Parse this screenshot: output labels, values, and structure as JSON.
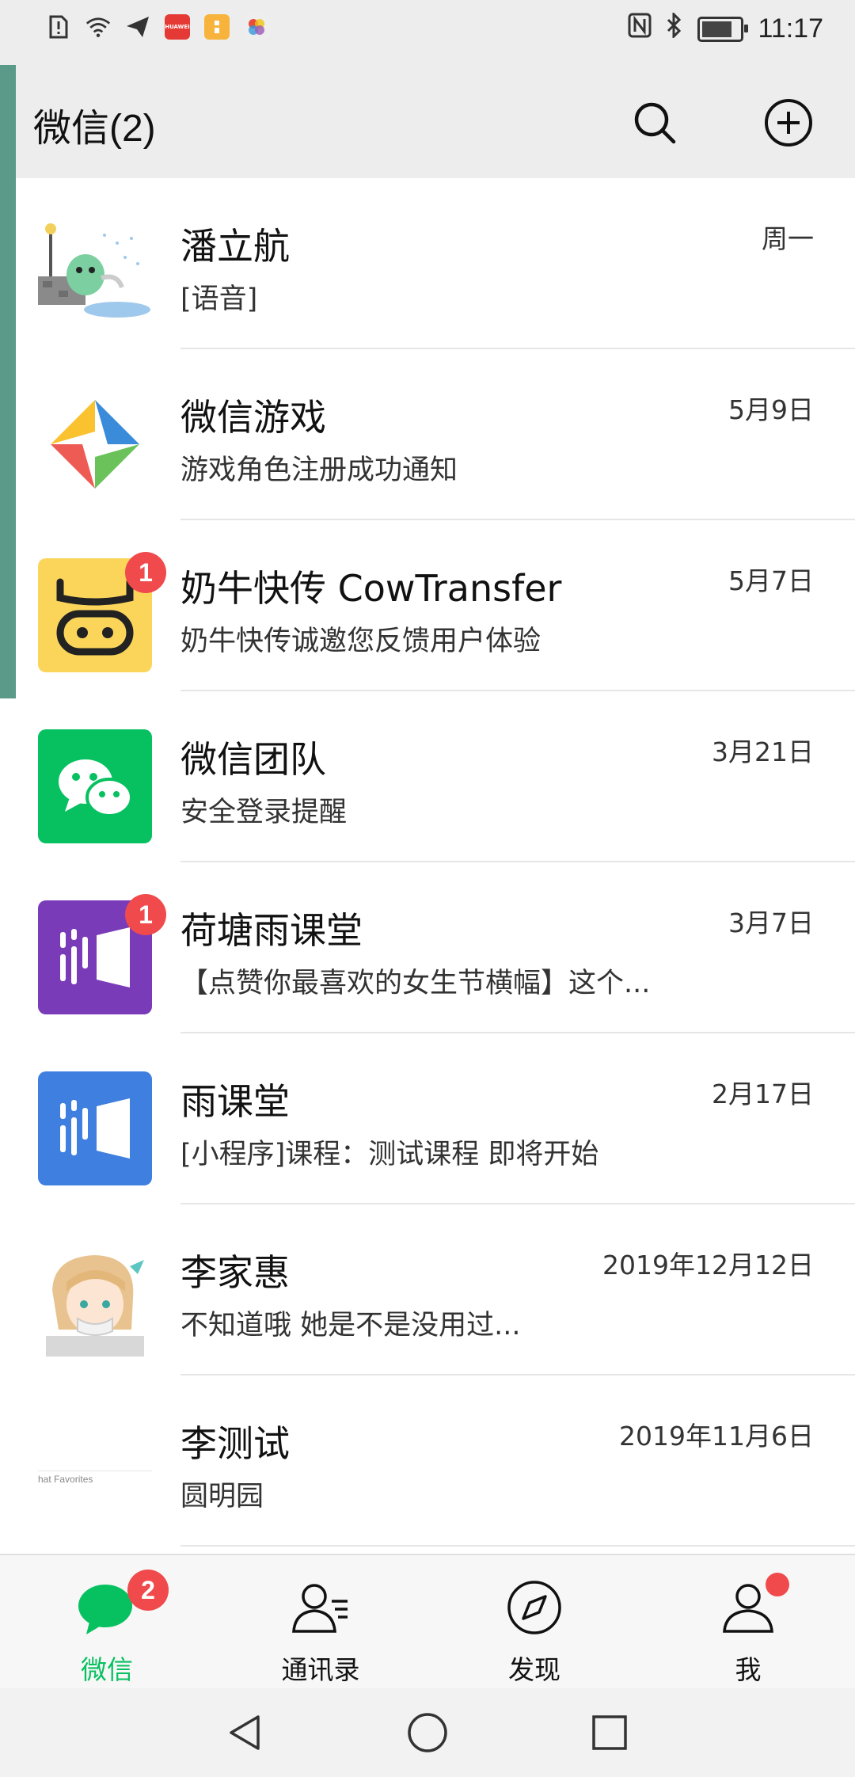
{
  "status_bar": {
    "time": "11:17",
    "left_icons": [
      "notification-alert-icon",
      "wifi-icon",
      "send-icon",
      "huawei-app-icon",
      "orange-app-icon",
      "photos-app-icon"
    ],
    "right_icons": [
      "nfc-icon",
      "bluetooth-icon",
      "battery-icon"
    ],
    "huawei_label": "HUAWEI"
  },
  "header": {
    "title": "微信(2)",
    "search_icon": "search-icon",
    "add_icon": "add-circle-icon"
  },
  "chats": [
    {
      "name": "潘立航",
      "preview": "[语音]",
      "time": "周一",
      "badge": "",
      "avatar": "cartoon-dinosaur"
    },
    {
      "name": "微信游戏",
      "preview": "游戏角色注册成功通知",
      "time": "5月9日",
      "badge": "",
      "avatar": "wechat-games-logo"
    },
    {
      "name": "奶牛快传 CowTransfer",
      "preview": "奶牛快传诚邀您反馈用户体验",
      "time": "5月7日",
      "badge": "1",
      "avatar": "cowtransfer-logo"
    },
    {
      "name": "微信团队",
      "preview": "安全登录提醒",
      "time": "3月21日",
      "badge": "",
      "avatar": "wechat-team-logo"
    },
    {
      "name": "荷塘雨课堂",
      "preview": "【点赞你最喜欢的女生节横幅】这个...",
      "time": "3月7日",
      "badge": "1",
      "avatar": "rain-classroom-purple-logo"
    },
    {
      "name": "雨课堂",
      "preview": "[小程序]课程：测试课程 即将开始",
      "time": "2月17日",
      "badge": "",
      "avatar": "rain-classroom-blue-logo"
    },
    {
      "name": "李家惠",
      "preview": "不知道哦 她是不是没用过...",
      "time": "2019年12月12日",
      "badge": "",
      "avatar": "anime-girl"
    },
    {
      "name": "李测试",
      "preview": "圆明园",
      "time": "2019年11月6日",
      "badge": "",
      "avatar": "chat-favorites-thumbnail",
      "avatar_caption": "hat Favorites"
    }
  ],
  "tabs": [
    {
      "label": "微信",
      "icon": "chat-bubble-icon",
      "badge": "2",
      "active": true
    },
    {
      "label": "通讯录",
      "icon": "contacts-icon",
      "badge": "",
      "active": false
    },
    {
      "label": "发现",
      "icon": "compass-icon",
      "badge": "",
      "active": false
    },
    {
      "label": "我",
      "icon": "profile-icon",
      "badge": "dot",
      "active": false
    }
  ],
  "nav": [
    "back-icon",
    "home-icon",
    "recents-icon"
  ],
  "colors": {
    "accent": "#07c160",
    "badge": "#f04a4c",
    "header_bg": "#ededed",
    "list_bg": "#ffffff"
  }
}
